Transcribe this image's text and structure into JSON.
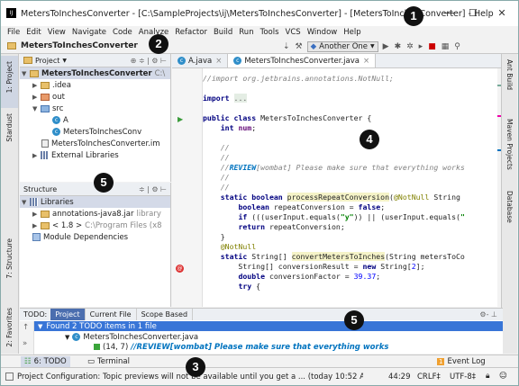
{
  "window": {
    "title": "MetersToInchesConverter - [C:\\SampleProjects\\ij\\MetersToInchesConverter] - [MetersToInchesConverter] - Help",
    "minimize": "—",
    "maximize": "☐",
    "close": "✕"
  },
  "menu": [
    "File",
    "Edit",
    "View",
    "Navigate",
    "Code",
    "Analyze",
    "Refactor",
    "Build",
    "Run",
    "Tools",
    "VCS",
    "Window",
    "Help"
  ],
  "navbar": {
    "breadcrumb": "MetersToInchesConverter",
    "run_config": "Another One"
  },
  "left_tools": {
    "project": "1: Project",
    "stardust": "Stardust",
    "structure": "7: Structure",
    "favorites": "2: Favorites"
  },
  "right_tools": {
    "ant": "Ant Build",
    "maven": "Maven Projects",
    "database": "Database"
  },
  "project_panel": {
    "header": "Project",
    "tree": [
      {
        "label": "MetersToInchesConverter",
        "path": "C:\\"
      },
      {
        "label": ".idea"
      },
      {
        "label": "out"
      },
      {
        "label": "src"
      },
      {
        "label": "A"
      },
      {
        "label": "MetersToInchesConv"
      },
      {
        "label": "MetersToInchesConverter.im"
      },
      {
        "label": "External Libraries"
      }
    ]
  },
  "structure_panel": {
    "header": "Structure",
    "tree": [
      {
        "label": "Libraries"
      },
      {
        "label": "annotations-java8.jar",
        "suffix": "library"
      },
      {
        "label": "< 1.8 >",
        "suffix": "C:\\Program Files (x8"
      },
      {
        "label": "Module Dependencies"
      }
    ]
  },
  "editor": {
    "tabs": [
      "A.java",
      "MetersToInchesConverter.java"
    ],
    "lines": [
      "//import org.jetbrains.annotations.NotNull;",
      "",
      "import ...",
      "",
      "public class MetersToInchesConverter {",
      "    int num;",
      "",
      "    //",
      "    //",
      "    //REVIEW[wombat] Please make sure that everything works",
      "    //",
      "    //",
      "    static boolean processRepeatConversion(@NotNull String",
      "        boolean repeatConversion = false;",
      "        if (((userInput.equals(\"y\")) || (userInput.equals(\"",
      "        return repeatConversion;",
      "    }",
      "    @NotNull",
      "    static String[] convertMetersToInches(String metersToCo",
      "        String[] conversionResult = new String[2];",
      "        double conversionFactor = 39.37;",
      "        try {"
    ]
  },
  "todo_panel": {
    "label": "TODO:",
    "tabs": [
      "Project",
      "Current File",
      "Scope Based"
    ],
    "summary": "Found 2 TODO items in 1 file",
    "file": "MetersToInchesConverter.java",
    "item_pos": "(14, 7)",
    "item_text": "//REVIEW[wombat] Please make sure that everything works"
  },
  "bottom_tools": {
    "todo": "6: TODO",
    "terminal": "Terminal",
    "event_log": "Event Log",
    "event_count": "1"
  },
  "status": {
    "message": "Project Configuration: Topic previews will not be available until you get a ... (today 10:52 AM)",
    "position": "44:29",
    "line_sep": "CRLF‡",
    "encoding": "UTF-8‡"
  },
  "callouts": [
    "1",
    "2",
    "3",
    "4",
    "5",
    "5"
  ],
  "colors": {
    "accent": "#4b6eaf",
    "run_green": "#3a9b3a",
    "todo_blue": "#0073bf"
  }
}
